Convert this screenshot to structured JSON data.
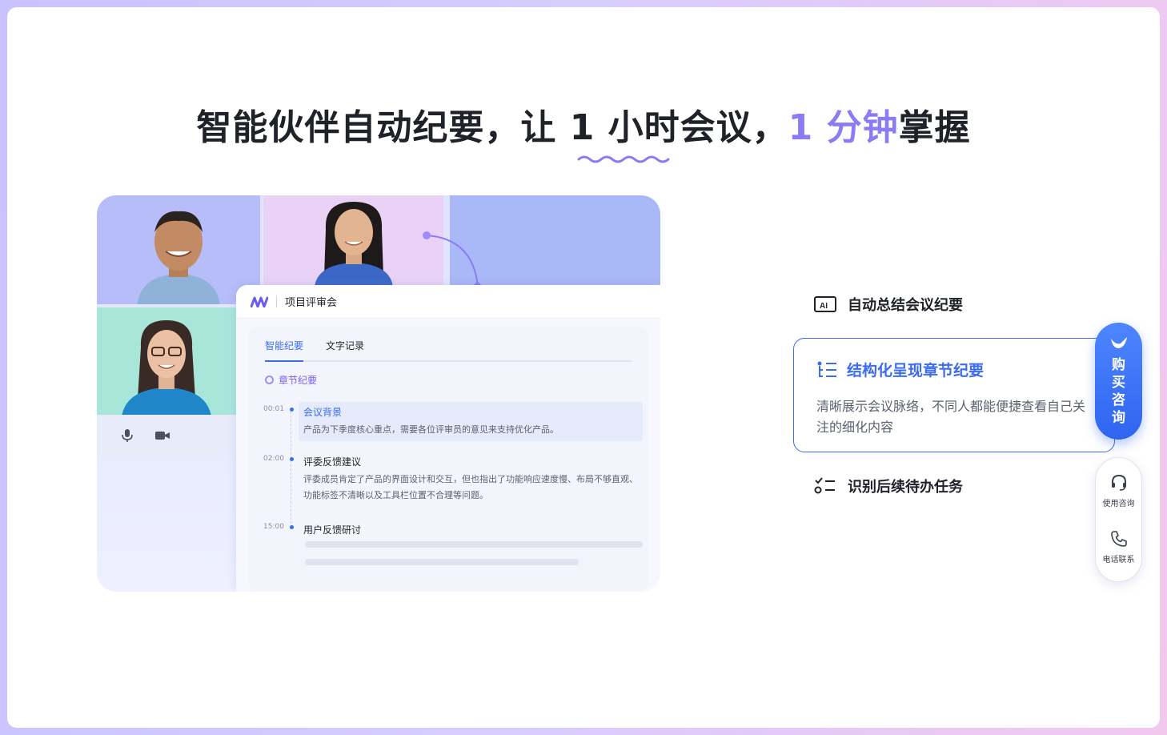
{
  "headline": {
    "part1": "智能伙伴自动纪要，让 ",
    "underlined": "1 小时",
    "part2": "会议，",
    "accent": "1 分钟",
    "part3": "掌握"
  },
  "panel": {
    "title": "项目评审会",
    "tabs": [
      {
        "label": "智能纪要",
        "active": true
      },
      {
        "label": "文字记录",
        "active": false
      }
    ],
    "chapter_heading": "章节纪要",
    "items": [
      {
        "time": "00:01",
        "title": "会议背景",
        "desc": "产品为下季度核心重点，需要各位评审员的意见来支持优化产品。"
      },
      {
        "time": "02:00",
        "title": "评委反馈建议",
        "desc": "评委成员肯定了产品的界面设计和交互，但也指出了功能响应速度慢、布局不够直观、功能标签不清晰以及工具栏位置不合理等问题。"
      },
      {
        "time": "15:00",
        "title": "用户反馈研讨",
        "desc": ""
      }
    ]
  },
  "features": [
    {
      "label": "自动总结会议纪要",
      "icon": "ai-icon"
    },
    {
      "label": "结构化呈现章节纪要",
      "icon": "structure-list-icon",
      "desc": "清晰展示会议脉络，不同人都能便捷查看自己关注的细化内容"
    },
    {
      "label": "识别后续待办任务",
      "icon": "todo-list-icon"
    }
  ],
  "side": {
    "buy_label": [
      "购",
      "买",
      "咨",
      "询"
    ],
    "help_items": [
      {
        "label": "使用咨询",
        "icon": "headset-icon"
      },
      {
        "label": "电话联系",
        "icon": "phone-icon"
      }
    ]
  },
  "colors": {
    "accent_purple": "#8b7cf6",
    "primary_blue": "#3b6cf0"
  }
}
